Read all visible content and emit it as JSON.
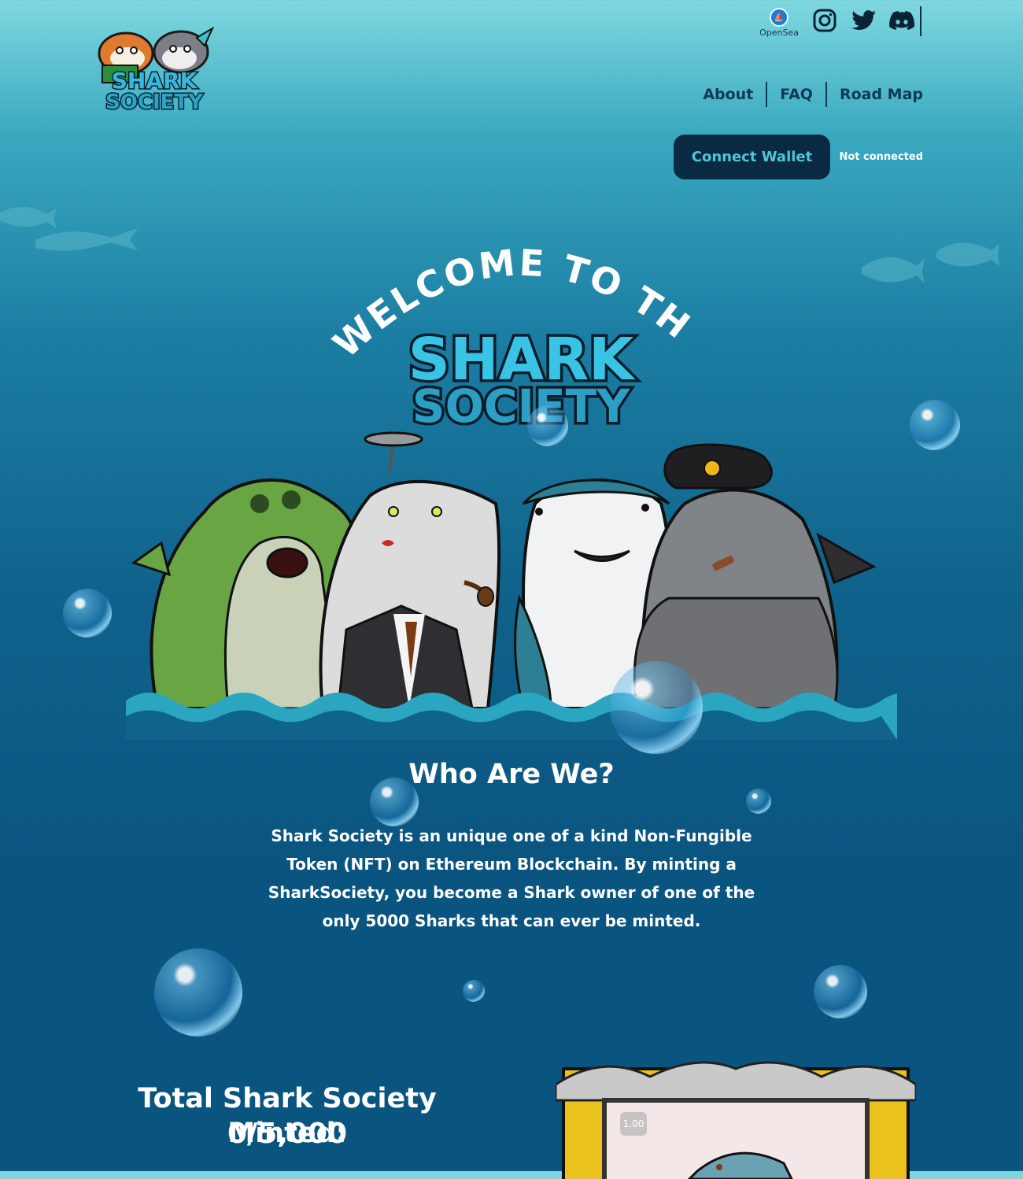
{
  "header": {
    "social": [
      {
        "name": "OpenSea",
        "label": "OpenSea",
        "icon": "opensea-icon"
      },
      {
        "name": "Instagram",
        "icon": "instagram-icon"
      },
      {
        "name": "Twitter",
        "icon": "twitter-icon"
      },
      {
        "name": "Discord",
        "icon": "discord-icon"
      }
    ],
    "nav": [
      {
        "label": "About"
      },
      {
        "label": "FAQ"
      },
      {
        "label": "Road Map"
      }
    ],
    "connect_label": "Connect Wallet",
    "status": "Not connected"
  },
  "hero": {
    "arc_text": "WELCOME TO THE",
    "logo_line1": "SHARK",
    "logo_line2": "SOCIETY"
  },
  "about": {
    "title": "Who Are We?",
    "body": "Shark Society is an unique one of a kind Non-Fungible Token (NFT) on Ethereum Blockchain. By minting a SharkSociety, you become a Shark owner of one of the only 5000 Sharks that can ever be minted."
  },
  "mint": {
    "label": "Total Shark Society Minted:",
    "value": "0/5,000",
    "price_chip": "1.00"
  },
  "colors": {
    "accent": "#4ec6d8",
    "button_bg": "#0a2a44",
    "nav_text": "#0d3a55"
  }
}
